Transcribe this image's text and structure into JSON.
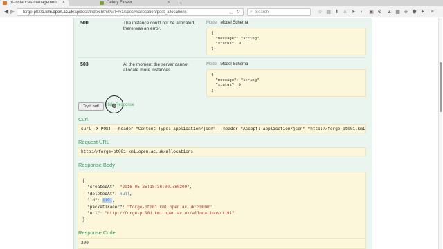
{
  "browser": {
    "tabs": [
      {
        "label": "pt-instances-management",
        "active": true,
        "favicon_color": "#e07b2c"
      },
      {
        "label": "Celery Flower",
        "active": false,
        "favicon_color": "#7aa33c"
      }
    ],
    "url_host_prefix": "forge-pt001.",
    "url_host_domain": "kmi.open.ac.uk",
    "url_path": "/apidocs/index.html?url=/v1/spec#!/allocation/post_allocations",
    "search_placeholder": "Search"
  },
  "responses": [
    {
      "code": "500",
      "description": "The instance could not be allocated, there was an error.",
      "tab_model": "Model",
      "tab_schema": "Model Schema",
      "schema": "{\n  \"message\": \"string\",\n  \"status\": 0\n}"
    },
    {
      "code": "503",
      "description": "At the moment the server cannot allocate more instances.",
      "tab_model": "Model",
      "tab_schema": "Model Schema",
      "schema": "{\n  \"message\": \"string\",\n  \"status\": 0\n}"
    }
  ],
  "actions": {
    "try_it_label": "Try it out!",
    "hide_response_label": "Hide Response"
  },
  "curl": {
    "title": "Curl",
    "command": "curl -X POST --header \"Content-Type: application/json\" --header \"Accept: application/json\" \"http://forge-pt001.kmi.open"
  },
  "request_url": {
    "title": "Request URL",
    "value": "http://forge-pt001.kmi.open.ac.uk/allocations"
  },
  "response_body": {
    "title": "Response Body",
    "open_brace": "{",
    "close_brace": "}",
    "fields": [
      {
        "key": "\"createdAt\": ",
        "value": "\"2016-05-25T18:36:00.780209\"",
        "kind": "str",
        "comma": ","
      },
      {
        "key": "\"deletedAt\": ",
        "value": "null",
        "kind": "num",
        "comma": ","
      },
      {
        "key": "\"id\": ",
        "value": "1191",
        "kind": "num-hl",
        "comma": ","
      },
      {
        "key": "\"packetTracer\": ",
        "value": "\"forge-pt001.kmi.open.ac.uk:39000\"",
        "kind": "str",
        "comma": ","
      },
      {
        "key": "\"url\": ",
        "value": "\"http://forge-pt001.kmi.open.ac.uk/allocations/1191\"",
        "kind": "str",
        "comma": ""
      }
    ]
  },
  "response_code": {
    "title": "Response Code",
    "value": "200"
  }
}
